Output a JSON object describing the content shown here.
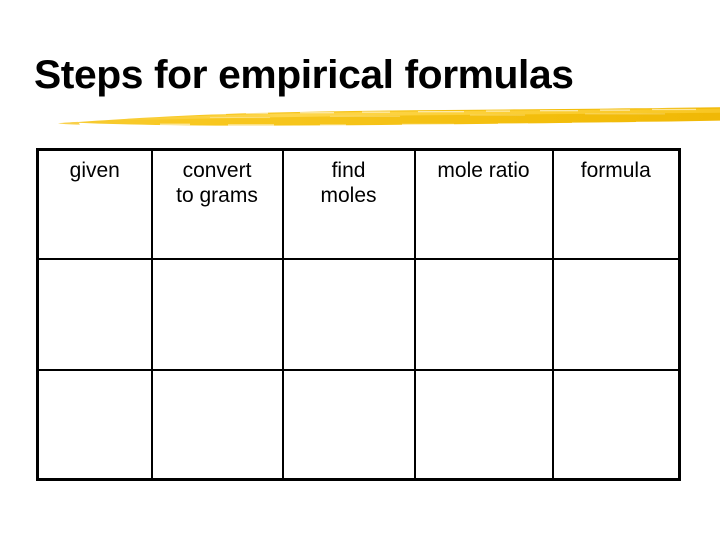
{
  "slide": {
    "title": "Steps for empirical formulas",
    "background_color": "#FFFFFF",
    "title_color": "#000000",
    "underline_color": "#F5C318",
    "underline_highlight_color": "#FFD84D",
    "underline_shadow_color": "#E8AE08",
    "table_border_color": "#000000"
  },
  "table": {
    "columns": 5,
    "rows": 3,
    "headers": [
      {
        "label": "given"
      },
      {
        "label": "convert\nto grams"
      },
      {
        "label": "find\nmoles"
      },
      {
        "label": "mole ratio"
      },
      {
        "label": "formula"
      }
    ],
    "body_rows": [
      {
        "cells": [
          "",
          "",
          "",
          "",
          ""
        ]
      },
      {
        "cells": [
          "",
          "",
          "",
          "",
          ""
        ]
      }
    ]
  }
}
